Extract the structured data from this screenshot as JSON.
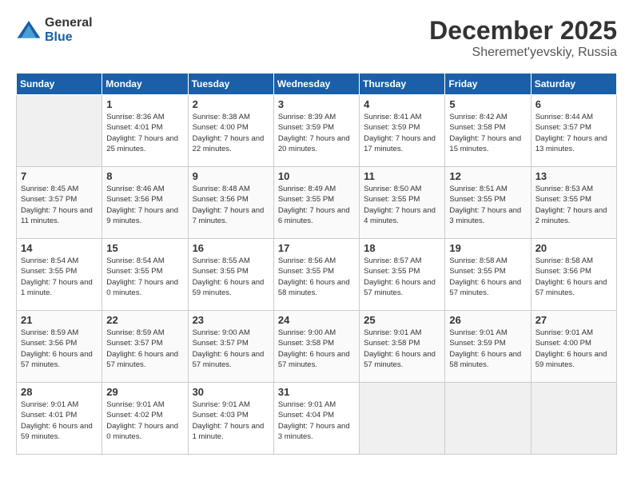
{
  "header": {
    "logo_general": "General",
    "logo_blue": "Blue",
    "month_title": "December 2025",
    "location": "Sheremet'yevskiy, Russia"
  },
  "days_of_week": [
    "Sunday",
    "Monday",
    "Tuesday",
    "Wednesday",
    "Thursday",
    "Friday",
    "Saturday"
  ],
  "weeks": [
    [
      {
        "day": "",
        "sunrise": "",
        "sunset": "",
        "daylight": ""
      },
      {
        "day": "1",
        "sunrise": "Sunrise: 8:36 AM",
        "sunset": "Sunset: 4:01 PM",
        "daylight": "Daylight: 7 hours and 25 minutes."
      },
      {
        "day": "2",
        "sunrise": "Sunrise: 8:38 AM",
        "sunset": "Sunset: 4:00 PM",
        "daylight": "Daylight: 7 hours and 22 minutes."
      },
      {
        "day": "3",
        "sunrise": "Sunrise: 8:39 AM",
        "sunset": "Sunset: 3:59 PM",
        "daylight": "Daylight: 7 hours and 20 minutes."
      },
      {
        "day": "4",
        "sunrise": "Sunrise: 8:41 AM",
        "sunset": "Sunset: 3:59 PM",
        "daylight": "Daylight: 7 hours and 17 minutes."
      },
      {
        "day": "5",
        "sunrise": "Sunrise: 8:42 AM",
        "sunset": "Sunset: 3:58 PM",
        "daylight": "Daylight: 7 hours and 15 minutes."
      },
      {
        "day": "6",
        "sunrise": "Sunrise: 8:44 AM",
        "sunset": "Sunset: 3:57 PM",
        "daylight": "Daylight: 7 hours and 13 minutes."
      }
    ],
    [
      {
        "day": "7",
        "sunrise": "Sunrise: 8:45 AM",
        "sunset": "Sunset: 3:57 PM",
        "daylight": "Daylight: 7 hours and 11 minutes."
      },
      {
        "day": "8",
        "sunrise": "Sunrise: 8:46 AM",
        "sunset": "Sunset: 3:56 PM",
        "daylight": "Daylight: 7 hours and 9 minutes."
      },
      {
        "day": "9",
        "sunrise": "Sunrise: 8:48 AM",
        "sunset": "Sunset: 3:56 PM",
        "daylight": "Daylight: 7 hours and 7 minutes."
      },
      {
        "day": "10",
        "sunrise": "Sunrise: 8:49 AM",
        "sunset": "Sunset: 3:55 PM",
        "daylight": "Daylight: 7 hours and 6 minutes."
      },
      {
        "day": "11",
        "sunrise": "Sunrise: 8:50 AM",
        "sunset": "Sunset: 3:55 PM",
        "daylight": "Daylight: 7 hours and 4 minutes."
      },
      {
        "day": "12",
        "sunrise": "Sunrise: 8:51 AM",
        "sunset": "Sunset: 3:55 PM",
        "daylight": "Daylight: 7 hours and 3 minutes."
      },
      {
        "day": "13",
        "sunrise": "Sunrise: 8:53 AM",
        "sunset": "Sunset: 3:55 PM",
        "daylight": "Daylight: 7 hours and 2 minutes."
      }
    ],
    [
      {
        "day": "14",
        "sunrise": "Sunrise: 8:54 AM",
        "sunset": "Sunset: 3:55 PM",
        "daylight": "Daylight: 7 hours and 1 minute."
      },
      {
        "day": "15",
        "sunrise": "Sunrise: 8:54 AM",
        "sunset": "Sunset: 3:55 PM",
        "daylight": "Daylight: 7 hours and 0 minutes."
      },
      {
        "day": "16",
        "sunrise": "Sunrise: 8:55 AM",
        "sunset": "Sunset: 3:55 PM",
        "daylight": "Daylight: 6 hours and 59 minutes."
      },
      {
        "day": "17",
        "sunrise": "Sunrise: 8:56 AM",
        "sunset": "Sunset: 3:55 PM",
        "daylight": "Daylight: 6 hours and 58 minutes."
      },
      {
        "day": "18",
        "sunrise": "Sunrise: 8:57 AM",
        "sunset": "Sunset: 3:55 PM",
        "daylight": "Daylight: 6 hours and 57 minutes."
      },
      {
        "day": "19",
        "sunrise": "Sunrise: 8:58 AM",
        "sunset": "Sunset: 3:55 PM",
        "daylight": "Daylight: 6 hours and 57 minutes."
      },
      {
        "day": "20",
        "sunrise": "Sunrise: 8:58 AM",
        "sunset": "Sunset: 3:56 PM",
        "daylight": "Daylight: 6 hours and 57 minutes."
      }
    ],
    [
      {
        "day": "21",
        "sunrise": "Sunrise: 8:59 AM",
        "sunset": "Sunset: 3:56 PM",
        "daylight": "Daylight: 6 hours and 57 minutes."
      },
      {
        "day": "22",
        "sunrise": "Sunrise: 8:59 AM",
        "sunset": "Sunset: 3:57 PM",
        "daylight": "Daylight: 6 hours and 57 minutes."
      },
      {
        "day": "23",
        "sunrise": "Sunrise: 9:00 AM",
        "sunset": "Sunset: 3:57 PM",
        "daylight": "Daylight: 6 hours and 57 minutes."
      },
      {
        "day": "24",
        "sunrise": "Sunrise: 9:00 AM",
        "sunset": "Sunset: 3:58 PM",
        "daylight": "Daylight: 6 hours and 57 minutes."
      },
      {
        "day": "25",
        "sunrise": "Sunrise: 9:01 AM",
        "sunset": "Sunset: 3:58 PM",
        "daylight": "Daylight: 6 hours and 57 minutes."
      },
      {
        "day": "26",
        "sunrise": "Sunrise: 9:01 AM",
        "sunset": "Sunset: 3:59 PM",
        "daylight": "Daylight: 6 hours and 58 minutes."
      },
      {
        "day": "27",
        "sunrise": "Sunrise: 9:01 AM",
        "sunset": "Sunset: 4:00 PM",
        "daylight": "Daylight: 6 hours and 59 minutes."
      }
    ],
    [
      {
        "day": "28",
        "sunrise": "Sunrise: 9:01 AM",
        "sunset": "Sunset: 4:01 PM",
        "daylight": "Daylight: 6 hours and 59 minutes."
      },
      {
        "day": "29",
        "sunrise": "Sunrise: 9:01 AM",
        "sunset": "Sunset: 4:02 PM",
        "daylight": "Daylight: 7 hours and 0 minutes."
      },
      {
        "day": "30",
        "sunrise": "Sunrise: 9:01 AM",
        "sunset": "Sunset: 4:03 PM",
        "daylight": "Daylight: 7 hours and 1 minute."
      },
      {
        "day": "31",
        "sunrise": "Sunrise: 9:01 AM",
        "sunset": "Sunset: 4:04 PM",
        "daylight": "Daylight: 7 hours and 3 minutes."
      },
      {
        "day": "",
        "sunrise": "",
        "sunset": "",
        "daylight": ""
      },
      {
        "day": "",
        "sunrise": "",
        "sunset": "",
        "daylight": ""
      },
      {
        "day": "",
        "sunrise": "",
        "sunset": "",
        "daylight": ""
      }
    ]
  ]
}
